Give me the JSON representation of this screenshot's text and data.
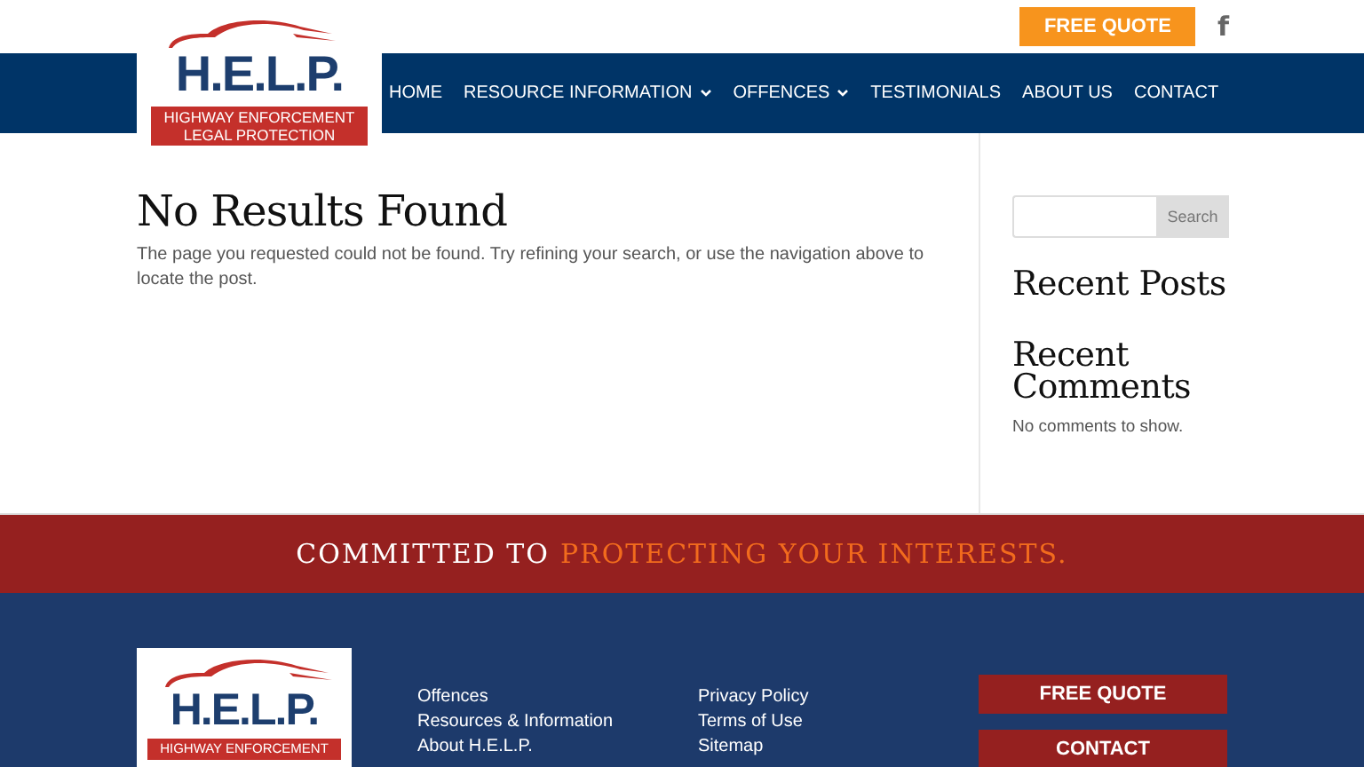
{
  "logo": {
    "title": "H.E.L.P.",
    "line_1": "HIGHWAY ENFORCEMENT",
    "line_2": "LEGAL PROTECTION"
  },
  "top_bar": {
    "quote_button": "FREE QUOTE",
    "social_icon": "f"
  },
  "nav": [
    {
      "label": "HOME",
      "has_submenu": false
    },
    {
      "label": "RESOURCE INFORMATION",
      "has_submenu": true
    },
    {
      "label": "OFFENCES",
      "has_submenu": true
    },
    {
      "label": "TESTIMONIALS",
      "has_submenu": false
    },
    {
      "label": "ABOUT US",
      "has_submenu": false
    },
    {
      "label": "CONTACT",
      "has_submenu": false
    }
  ],
  "main": {
    "heading": "No Results Found",
    "message": "The page you requested could not be found. Try refining your search, or use the navigation above to locate the post."
  },
  "sidebar": {
    "search_button": "Search",
    "recent_posts": "Recent Posts",
    "recent_comments": "Recent Comments",
    "no_comments": "No comments to show."
  },
  "banner": {
    "lead": "COMMITTED TO",
    "highlight": "PROTECTING YOUR INTERESTS."
  },
  "footer": {
    "logo": {
      "title": "H.E.L.P.",
      "line_1": "HIGHWAY ENFORCEMENT"
    },
    "links_1": [
      "Offences",
      "Resources & Information",
      "About H.E.L.P."
    ],
    "links_2": [
      "Privacy Policy",
      "Terms of Use",
      "Sitemap"
    ],
    "buttons": [
      "FREE QUOTE",
      "CONTACT"
    ]
  }
}
